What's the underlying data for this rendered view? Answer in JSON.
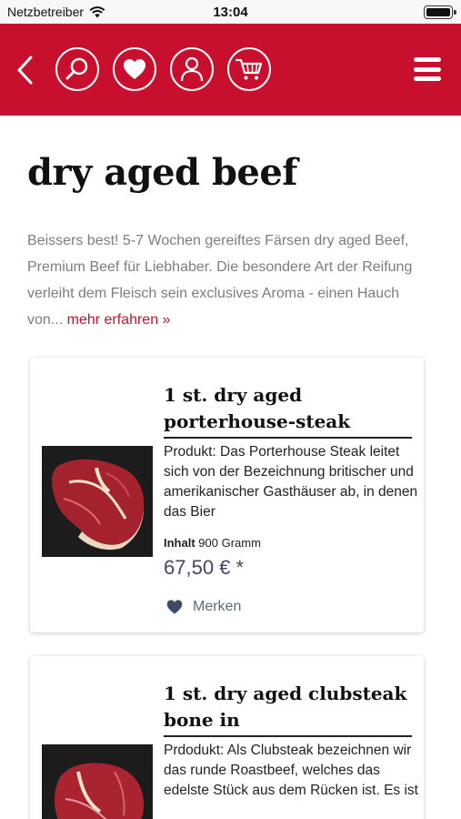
{
  "status_bar": {
    "carrier": "Netzbetreiber",
    "time": "13:04"
  },
  "header": {
    "back_icon": "chevron-left-icon",
    "search_icon": "search-icon",
    "wishlist_icon": "heart-icon",
    "account_icon": "user-icon",
    "cart_icon": "cart-icon",
    "menu_icon": "hamburger-menu-icon",
    "background": "#c8102e"
  },
  "page": {
    "title": "dry aged beef",
    "intro": "Beissers best! 5-7 Wochen gereiftes Färsen dry aged Beef, Premium Beef für Liebhaber. Die besondere Art der Reifung verleiht dem Fleisch sein exclusives Aroma - einen Hauch von...",
    "more_link": "mehr erfahren »"
  },
  "products": [
    {
      "name": "1 st. dry aged porterhouse-steak",
      "description": "Produkt: Das Porterhouse Steak leitet sich von der Bezeichnung britischer und amerikanischer Gasthäuser ab, in denen das Bier",
      "content_label": "Inhalt",
      "content_value": "900 Gramm",
      "price": "67,50 € *",
      "wishlist_label": "Merken"
    },
    {
      "name": "1 st. dry aged clubsteak bone in",
      "description": "Prdodukt: Als Clubsteak bezeichnen wir das runde Roastbeef, welches das edelste Stück aus dem Rücken ist. Es ist"
    }
  ],
  "colors": {
    "accent": "#c8102e",
    "price": "#3c4a63",
    "muted_text": "#7d7d7d"
  }
}
